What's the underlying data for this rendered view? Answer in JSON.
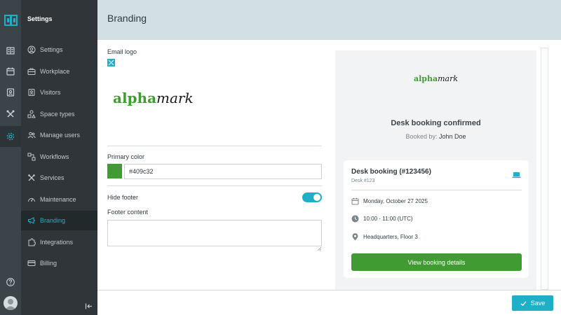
{
  "app": {
    "section_title": "Settings",
    "page_title": "Branding",
    "collapse_icon": "collapse-sidebar-icon",
    "help_icon": "help-icon"
  },
  "rail": {
    "items": [
      {
        "icon": "building-icon"
      },
      {
        "icon": "calendar-icon"
      },
      {
        "icon": "visitor-badge-icon"
      },
      {
        "icon": "tools-icon"
      },
      {
        "icon": "gear-icon",
        "active": true
      }
    ]
  },
  "nav": {
    "items": [
      {
        "label": "Settings",
        "icon": "user-circle-icon"
      },
      {
        "label": "Workplace",
        "icon": "briefcase-icon"
      },
      {
        "label": "Visitors",
        "icon": "visitor-badge-icon"
      },
      {
        "label": "Space types",
        "icon": "shapes-icon"
      },
      {
        "label": "Manage users",
        "icon": "users-icon"
      },
      {
        "label": "Workflows",
        "icon": "workflow-icon"
      },
      {
        "label": "Services",
        "icon": "tools-icon"
      },
      {
        "label": "Maintenance",
        "icon": "gauge-icon"
      },
      {
        "label": "Branding",
        "icon": "megaphone-icon",
        "active": true
      },
      {
        "label": "Integrations",
        "icon": "puzzle-icon"
      },
      {
        "label": "Billing",
        "icon": "credit-card-icon"
      }
    ]
  },
  "form": {
    "email_logo_label": "Email logo",
    "logo_wordmark_green": "alpha",
    "logo_wordmark_dark": "mark",
    "primary_color_label": "Primary color",
    "primary_color_value": "#409c32",
    "hide_footer_label": "Hide footer",
    "hide_footer_on": true,
    "footer_content_label": "Footer content",
    "footer_content_value": ""
  },
  "preview": {
    "brand_green": "alpha",
    "brand_dark": "mark",
    "title": "Desk booking confirmed",
    "booked_by_prefix": "Booked by:",
    "booked_by_name": "John Doe",
    "card": {
      "title": "Desk booking (#123456)",
      "subtitle": "Desk #123",
      "date": "Monday, October 27 2025",
      "time": "10:00 - 11:00 (UTC)",
      "location": "Headquarters, Floor 3",
      "button_label": "View booking details"
    }
  },
  "actions": {
    "save_label": "Save"
  },
  "colors": {
    "accent": "#1fb0c8",
    "brand_green": "#409c32",
    "sidebar": "#2f3538",
    "header": "#d2e0e5"
  }
}
